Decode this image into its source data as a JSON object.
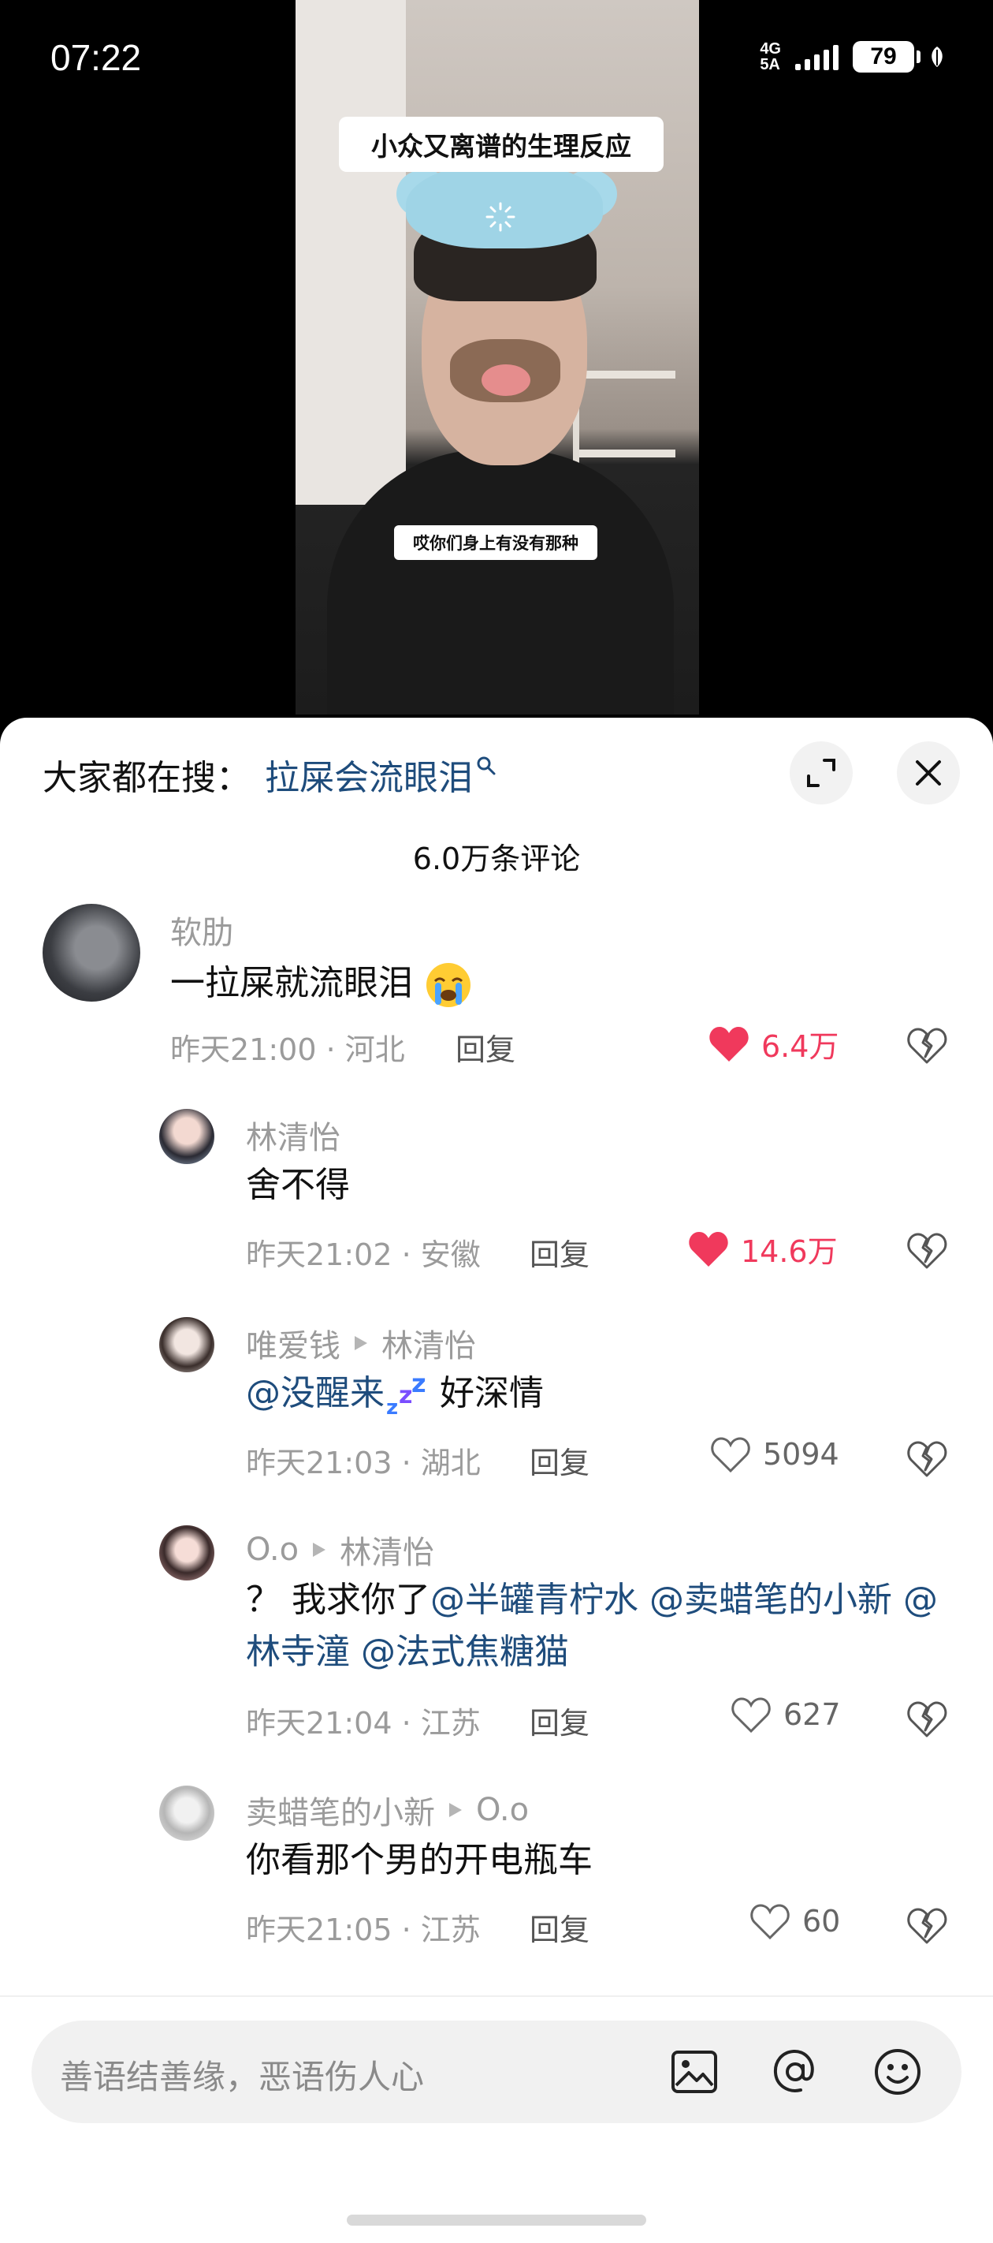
{
  "status_bar": {
    "time": "07:22",
    "network": "4G 5A",
    "battery": "79"
  },
  "video": {
    "title": "小众又离谱的生理反应",
    "subtitle": "哎你们身上有没有那种"
  },
  "sheet": {
    "search_prefix": "大家都在搜：",
    "search_term": "拉屎会流眼泪",
    "comment_count": "6.0万条评论"
  },
  "comments": [
    {
      "author": "软肋",
      "text": "一拉屎就流眼泪",
      "meta": "昨天21:00 · 河北",
      "reply": "回复",
      "likes": "6.4万",
      "liked": true
    },
    {
      "author": "林清怡",
      "text": "舍不得",
      "meta": "昨天21:02 · 安徽",
      "reply": "回复",
      "likes": "14.6万",
      "liked": true
    },
    {
      "author": "唯爱钱",
      "reply_to": "林清怡",
      "mention": "@没醒来",
      "text": " 好深情",
      "meta": "昨天21:03 · 湖北",
      "reply": "回复",
      "likes": "5094",
      "liked": false
    },
    {
      "author": "O.o",
      "reply_to": "林清怡",
      "text_prefix": "？ 我求你了",
      "mentions": [
        "@半罐青柠水",
        "@卖蜡笔的小新",
        "@林寺潼",
        "@法式焦糖猫"
      ],
      "meta": "昨天21:04 · 江苏",
      "reply": "回复",
      "likes": "627",
      "liked": false
    },
    {
      "author": "卖蜡笔的小新",
      "reply_to": "O.o",
      "text": "你看那个男的开电瓶车",
      "meta": "昨天21:05 · 江苏",
      "reply": "回复",
      "likes": "60",
      "liked": false
    }
  ],
  "input": {
    "placeholder": "善语结善缘，恶语伤人心"
  },
  "icons": [
    "search-icon",
    "expand-icon",
    "close-icon",
    "heart-icon",
    "dislike-icon",
    "image-icon",
    "at-icon",
    "emoji-icon"
  ],
  "colors": {
    "accent_like": "#f0395c",
    "mention": "#1e4c7c",
    "meta": "#9b9b9b"
  }
}
